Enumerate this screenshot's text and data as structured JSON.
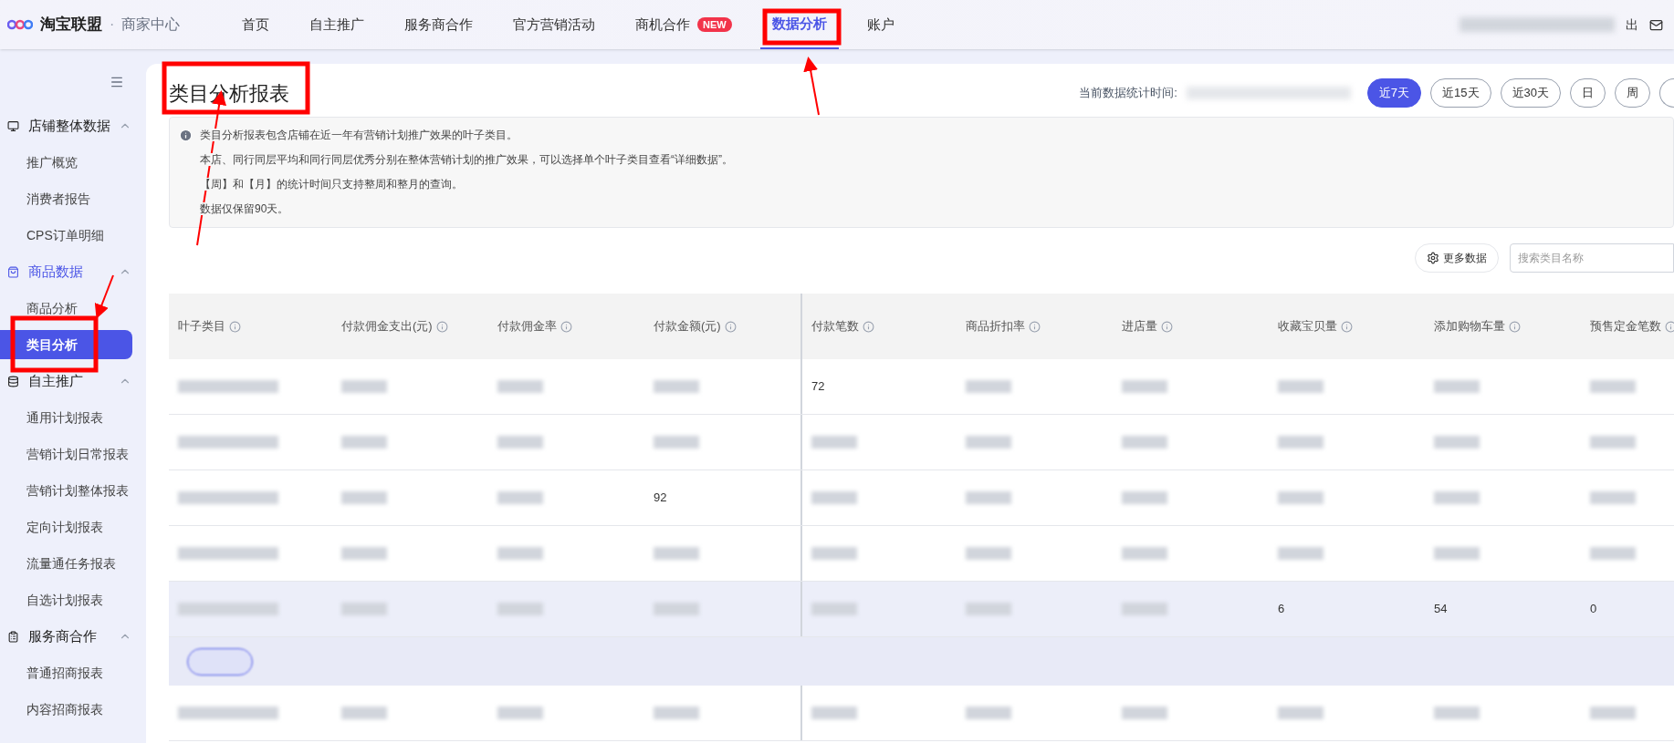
{
  "brand": {
    "name": "淘宝联盟",
    "separator": "·",
    "sub": "商家中心"
  },
  "nav": [
    {
      "label": "首页",
      "selected": false
    },
    {
      "label": "自主推广",
      "selected": false
    },
    {
      "label": "服务商合作",
      "selected": false
    },
    {
      "label": "官方营销活动",
      "selected": false
    },
    {
      "label": "商机合作",
      "selected": false,
      "badge": "NEW"
    },
    {
      "label": "数据分析",
      "selected": true
    },
    {
      "label": "账户",
      "selected": false
    }
  ],
  "user": {
    "logout": "出"
  },
  "sidebar": [
    {
      "label": "店铺整体数据",
      "expanded": true,
      "active": false,
      "children": [
        {
          "label": "推广概览",
          "selected": false
        },
        {
          "label": "消费者报告",
          "selected": false
        },
        {
          "label": "CPS订单明细",
          "selected": false
        }
      ]
    },
    {
      "label": "商品数据",
      "expanded": true,
      "active": true,
      "children": [
        {
          "label": "商品分析",
          "selected": false
        },
        {
          "label": "类目分析",
          "selected": true
        }
      ]
    },
    {
      "label": "自主推广",
      "expanded": true,
      "active": false,
      "children": [
        {
          "label": "通用计划报表",
          "selected": false
        },
        {
          "label": "营销计划日常报表",
          "selected": false
        },
        {
          "label": "营销计划整体报表",
          "selected": false
        },
        {
          "label": "定向计划报表",
          "selected": false
        },
        {
          "label": "流量通任务报表",
          "selected": false
        },
        {
          "label": "自选计划报表",
          "selected": false
        }
      ]
    },
    {
      "label": "服务商合作",
      "expanded": true,
      "active": false,
      "children": [
        {
          "label": "普通招商报表",
          "selected": false
        },
        {
          "label": "内容招商报表",
          "selected": false
        }
      ]
    }
  ],
  "page": {
    "title": "类目分析报表",
    "time_label": "当前数据统计时间:",
    "ranges": [
      {
        "label": "近7天",
        "selected": true
      },
      {
        "label": "近15天",
        "selected": false
      },
      {
        "label": "近30天",
        "selected": false
      },
      {
        "label": "日",
        "selected": false
      },
      {
        "label": "周",
        "selected": false
      }
    ]
  },
  "notice": [
    "类目分析报表包含店铺在近一年有营销计划推广效果的叶子类目。",
    "本店、同行同层平均和同行同层优秀分别在整体营销计划的推广效果，可以选择单个叶子类目查看“详细数据”。",
    "【周】和【月】的统计时间只支持整周和整月的查询。",
    "数据仅保留90天。"
  ],
  "toolbar": {
    "more": "更多数据",
    "search_placeholder": "搜索类目名称"
  },
  "table": {
    "columns": [
      "叶子类目",
      "付款佣金支出(元)",
      "付款佣金率",
      "付款金额(元)",
      "付款笔数",
      "商品折扣率",
      "进店量",
      "收藏宝贝量",
      "添加购物车量",
      "预售定金笔数"
    ],
    "rows": [
      {
        "kind": "data",
        "highlighted": false,
        "cells": [
          null,
          null,
          null,
          null,
          "72",
          null,
          null,
          null,
          null,
          null
        ]
      },
      {
        "kind": "data",
        "highlighted": false,
        "cells": [
          null,
          null,
          null,
          null,
          null,
          null,
          null,
          null,
          null,
          null
        ]
      },
      {
        "kind": "data",
        "highlighted": false,
        "cells": [
          null,
          null,
          null,
          "92",
          null,
          null,
          null,
          null,
          null,
          null
        ]
      },
      {
        "kind": "data",
        "highlighted": false,
        "cells": [
          null,
          null,
          null,
          null,
          null,
          null,
          null,
          null,
          null,
          null
        ]
      },
      {
        "kind": "data",
        "highlighted": true,
        "cells": [
          null,
          null,
          null,
          null,
          null,
          null,
          null,
          "6",
          "54",
          "0"
        ]
      },
      {
        "kind": "expand"
      },
      {
        "kind": "data",
        "highlighted": false,
        "cells": [
          null,
          null,
          null,
          null,
          null,
          null,
          null,
          null,
          null,
          null
        ]
      }
    ]
  }
}
